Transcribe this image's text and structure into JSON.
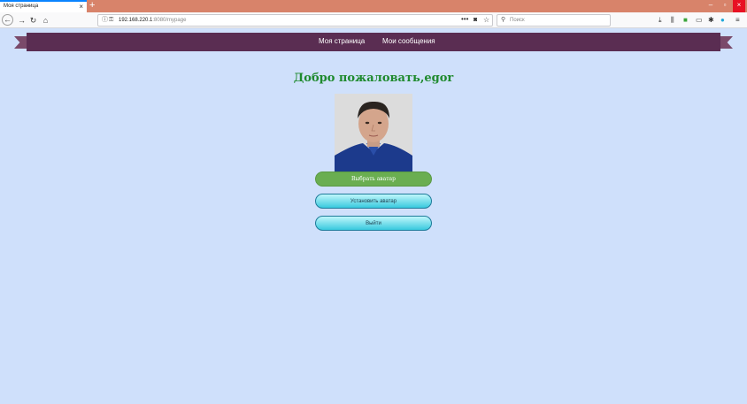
{
  "browser": {
    "tab_title": "Моя страница",
    "tab_close": "×",
    "new_tab": "+",
    "url_host": "192.168.220.1",
    "url_rest": ":8080/mypage",
    "search_placeholder": "Поиск",
    "window_controls": [
      "–",
      "▫",
      "×"
    ],
    "colors": {
      "titlebar": "#d8836a",
      "tab_accent": "#0a84ff"
    }
  },
  "menu": {
    "items": [
      {
        "label": "Моя страница"
      },
      {
        "label": "Мои сообщения"
      }
    ],
    "colors": {
      "ribbon": "#5a2d52"
    }
  },
  "page": {
    "welcome": "Добро пожаловать,egor",
    "buttons": {
      "choose_avatar": "Выбрать аватар",
      "set_avatar": "Установить аватар",
      "logout": "Выйти"
    },
    "colors": {
      "background": "#cfe0fb",
      "welcome": "#1f8a2e",
      "choose": "#6aae51",
      "cyan": "#39c9de"
    }
  }
}
